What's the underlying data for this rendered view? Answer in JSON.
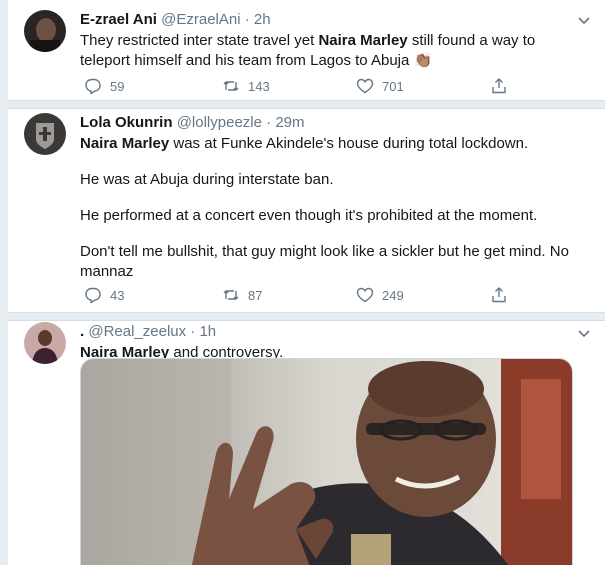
{
  "tweets": [
    {
      "name": "E-zrael Ani",
      "handle": "@EzraelAni",
      "time": "2h",
      "text_a": "They restricted inter state travel yet ",
      "text_bold": "Naira Marley",
      "text_b": " still found a way to teleport himself and his team from Lagos to Abuja ",
      "emoji": "👏🏽",
      "replies": "59",
      "retweets": "143",
      "likes": "701"
    },
    {
      "name": "Lola Okunrin",
      "handle": "@lollypeezle",
      "time": "29m",
      "p1_bold": "Naira Marley",
      "p1_rest": " was at Funke Akindele's house during total lockdown.",
      "p2": "He was at Abuja during interstate ban.",
      "p3": "He performed at a concert even though it's prohibited at the moment.",
      "p4": "Don't tell me bullshit, that guy might look like a sickler but he get mind. No mannaz",
      "replies": "43",
      "retweets": "87",
      "likes": "249"
    },
    {
      "name": ".",
      "handle": "@Real_zeelux",
      "time": "1h",
      "text_bold": "Naira Marley",
      "text_rest": " and controversy."
    }
  ],
  "separator": " · ",
  "icons": [
    "chevron-down-icon",
    "reply-icon",
    "retweet-icon",
    "like-icon",
    "share-icon"
  ],
  "colors": {
    "text": "#14171a",
    "muted": "#657786",
    "background": "#e6ecf0"
  }
}
